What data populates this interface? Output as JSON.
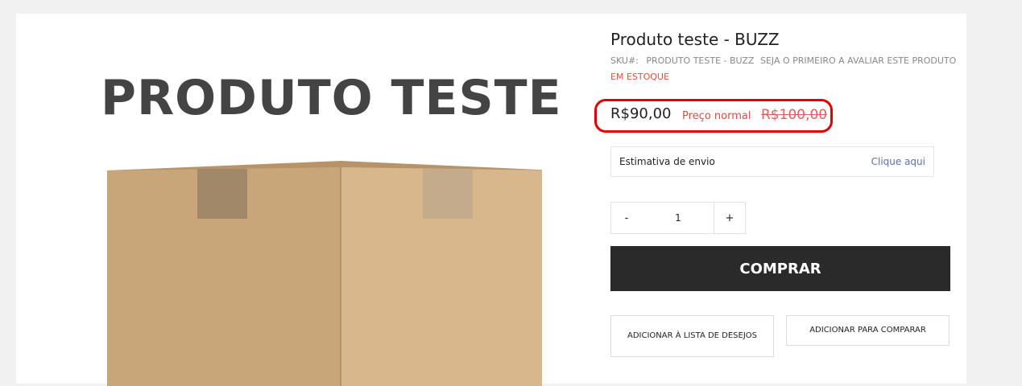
{
  "product": {
    "title": "Produto teste - BUZZ",
    "image_caption": "PRODUTO TESTE",
    "sku_label": "SKU#:",
    "sku_value": "PRODUTO TESTE - BUZZ",
    "review_link": "SEJA O PRIMEIRO A AVALIAR ESTE PRODUTO",
    "stock_status": "EM ESTOQUE",
    "price": "R$90,00",
    "old_price_label": "Preço normal",
    "old_price": "R$100,00"
  },
  "shipping": {
    "label": "Estimativa de envio",
    "link": "Clique aqui"
  },
  "quantity": {
    "minus": "-",
    "value": "1",
    "plus": "+"
  },
  "actions": {
    "buy": "COMPRAR",
    "wishlist": "ADICIONAR À LISTA DE DESEJOS",
    "compare": "ADICIONAR PARA COMPARAR"
  },
  "colors": {
    "highlight": "#e30000",
    "buy_button": "#2a2a2a",
    "stock": "#e0523a",
    "link": "#5a6fb0"
  }
}
